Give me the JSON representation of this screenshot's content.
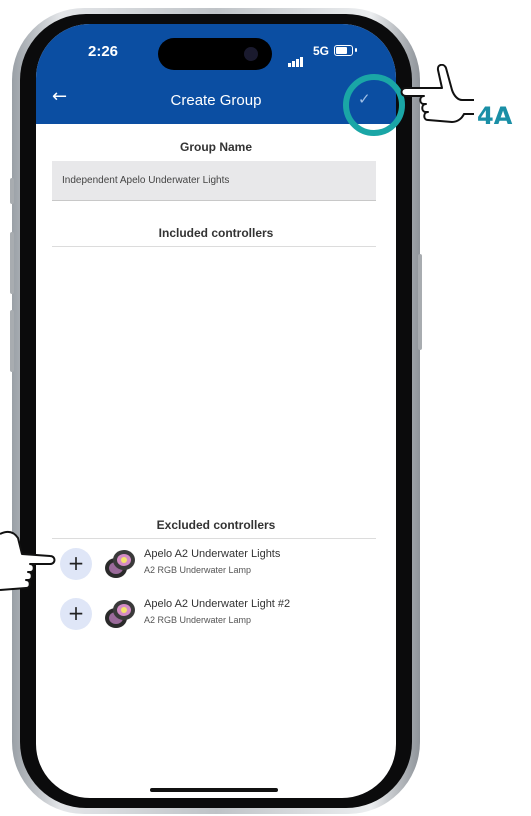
{
  "status_bar": {
    "time": "2:26",
    "network": "5G"
  },
  "header": {
    "title": "Create Group"
  },
  "group_name": {
    "label": "Group Name",
    "value": "Independent Apelo Underwater Lights"
  },
  "included": {
    "label": "Included controllers"
  },
  "excluded": {
    "label": "Excluded controllers",
    "items": [
      {
        "name": "Apelo A2 Underwater Lights",
        "subtitle": "A2 RGB Underwater Lamp"
      },
      {
        "name": "Apelo A2 Underwater Light #2",
        "subtitle": "A2 RGB Underwater Lamp"
      }
    ]
  },
  "callout": {
    "label": "4A",
    "color": "#1aa6a6"
  },
  "colors": {
    "header": "#0b4ea2",
    "add_button": "#dfe6f7"
  },
  "icons": {
    "back": "arrow-left-icon",
    "confirm": "check-icon",
    "add": "plus-icon",
    "device": "lamp-icon"
  }
}
